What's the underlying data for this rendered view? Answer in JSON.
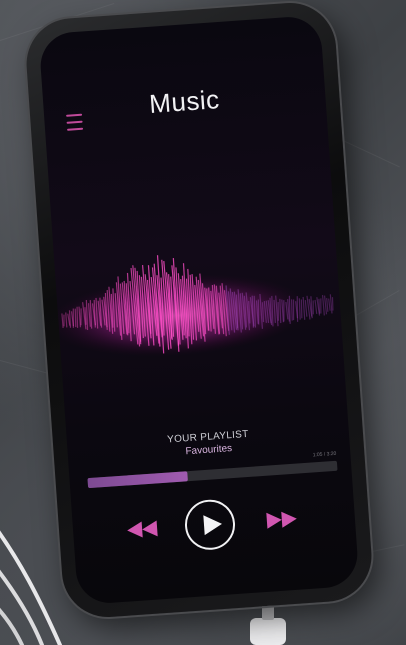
{
  "app": {
    "title": "Music"
  },
  "playlist": {
    "label": "YOUR PLAYLIST",
    "name": "Favourites"
  },
  "playback": {
    "time": "1:05 / 3:20",
    "progress_fraction": 0.4
  },
  "icons": {
    "menu": "hamburger-menu-icon",
    "rewind": "rewind-icon",
    "play": "play-icon",
    "fast_forward": "fast-forward-icon"
  },
  "colors": {
    "accent": "#c04a9a",
    "wave": "#e040b8"
  }
}
